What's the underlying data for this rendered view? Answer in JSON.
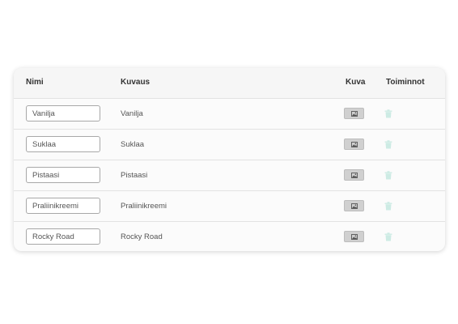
{
  "table": {
    "headers": {
      "name": "Nimi",
      "description": "Kuvaus",
      "image": "Kuva",
      "actions": "Toiminnot"
    },
    "rows": [
      {
        "name": "Vanilja",
        "description": "Vanilja"
      },
      {
        "name": "Suklaa",
        "description": "Suklaa"
      },
      {
        "name": "Pistaasi",
        "description": "Pistaasi"
      },
      {
        "name": "Praliinikreemi",
        "description": "Praliinikreemi"
      },
      {
        "name": "Rocky Road",
        "description": "Rocky Road"
      }
    ]
  },
  "icons": {
    "image_button": "image-icon",
    "delete_button": "trash-icon"
  },
  "colors": {
    "trash_icon": "#cdebe4",
    "image_button_bg": "#d0d0d0",
    "row_border": "#e2e2e2"
  }
}
